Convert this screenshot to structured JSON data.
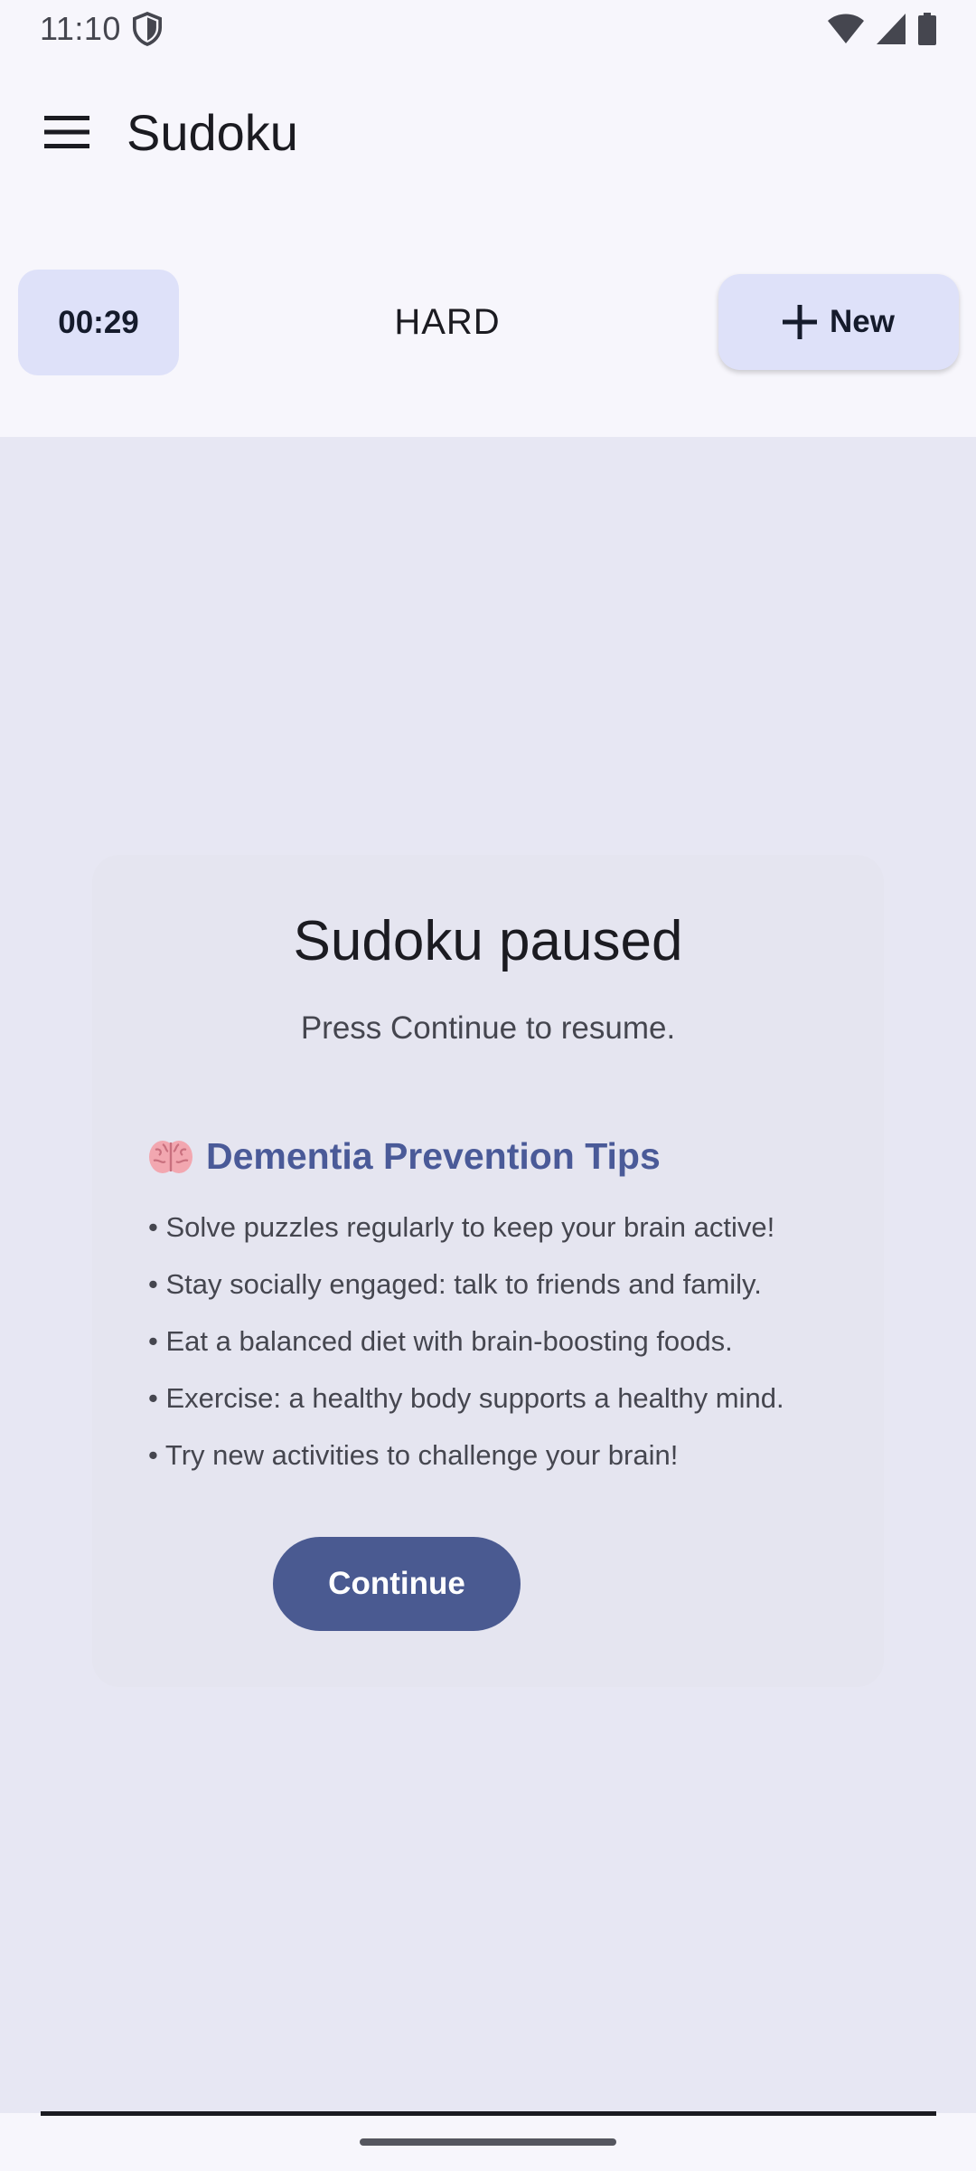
{
  "status_bar": {
    "time": "11:10",
    "icons": [
      "shield-icon",
      "wifi-icon",
      "cellular-signal-icon",
      "battery-icon"
    ]
  },
  "app_bar": {
    "menu_icon": "menu-icon",
    "title": "Sudoku"
  },
  "game_header": {
    "timer": "00:29",
    "difficulty": "HARD",
    "new_button_icon": "plus-icon",
    "new_button_label": "New"
  },
  "pause_card": {
    "title": "Sudoku paused",
    "subtitle": "Press Continue to resume.",
    "tips_icon": "brain-icon",
    "tips_heading": "Dementia Prevention Tips",
    "tips": [
      "• Solve puzzles regularly to keep your brain active!",
      "• Stay socially engaged: talk to friends and family.",
      "• Eat a balanced diet with brain-boosting foods.",
      "• Exercise: a healthy body supports a healthy mind.",
      "• Try new activities to challenge your brain!"
    ],
    "continue_label": "Continue"
  },
  "colors": {
    "background": "#F7F6FC",
    "content_background": "#E7E7F3",
    "chip_background": "#DEE1F9",
    "accent": "#4A5A91",
    "tips_heading": "#4A5A98"
  }
}
